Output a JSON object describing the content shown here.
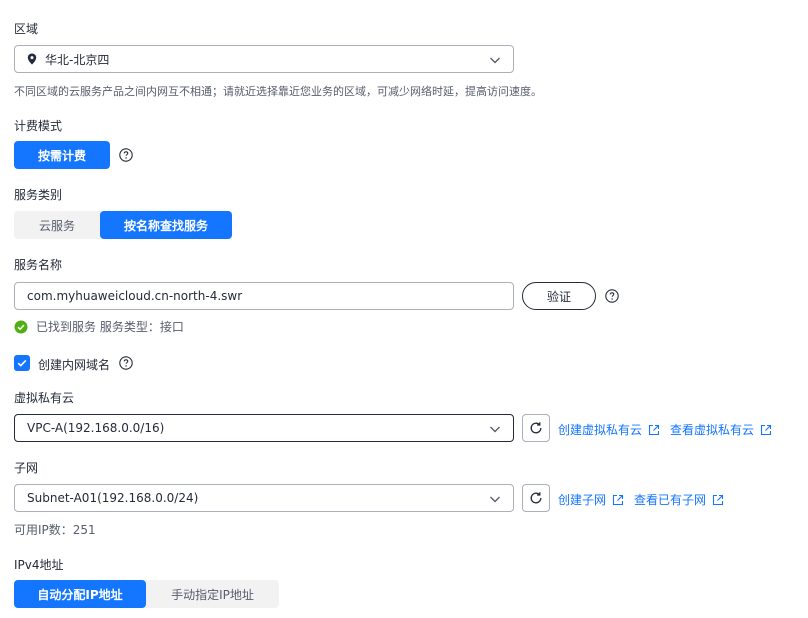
{
  "region": {
    "label": "区域",
    "value": "华北-北京四",
    "hint": "不同区域的云服务产品之间内网互不相通；请就近选择靠近您业务的区域，可减少网络时延，提高访问速度。"
  },
  "billing": {
    "label": "计费模式",
    "option": "按需计费"
  },
  "service_type": {
    "label": "服务类别",
    "options": [
      "云服务",
      "按名称查找服务"
    ],
    "selected": "按名称查找服务"
  },
  "service_name": {
    "label": "服务名称",
    "value": "com.myhuaweicloud.cn-north-4.swr",
    "verify_label": "验证",
    "status": "已找到服务 服务类型：接口"
  },
  "private_dns": {
    "label": "创建内网域名",
    "checked": true
  },
  "vpc": {
    "label": "虚拟私有云",
    "value": "VPC-A(192.168.0.0/16)",
    "create_link": "创建虚拟私有云",
    "view_link": "查看虚拟私有云"
  },
  "subnet": {
    "label": "子网",
    "value": "Subnet-A01(192.168.0.0/24)",
    "create_link": "创建子网",
    "view_link": "查看已有子网",
    "available_ips": "可用IP数：251"
  },
  "ipv4": {
    "label": "IPv4地址",
    "options": [
      "自动分配IP地址",
      "手动指定IP地址"
    ],
    "selected": "自动分配IP地址"
  },
  "colors": {
    "primary": "#1476ff",
    "success": "#50b012",
    "text": "#252b3a",
    "secondary_text": "#575d6c",
    "border": "#adb0b8"
  }
}
